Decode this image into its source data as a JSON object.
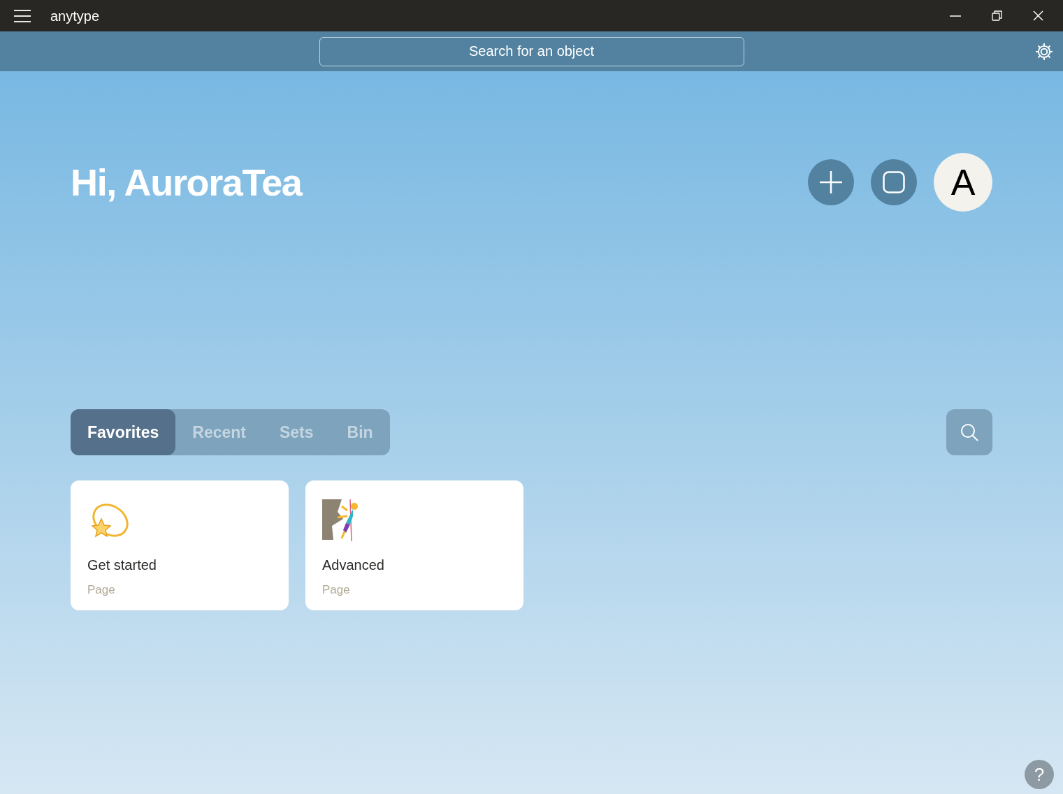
{
  "window": {
    "title": "anytype"
  },
  "search": {
    "placeholder": "Search for an object"
  },
  "greeting": "Hi, AuroraTea",
  "avatar": {
    "letter": "A"
  },
  "tabs": [
    {
      "label": "Favorites",
      "selected": true
    },
    {
      "label": "Recent",
      "selected": false
    },
    {
      "label": "Sets",
      "selected": false
    },
    {
      "label": "Bin",
      "selected": false
    }
  ],
  "cards": [
    {
      "title": "Get started",
      "type": "Page",
      "kind": "star"
    },
    {
      "title": "Advanced",
      "type": "Page",
      "kind": "climber"
    }
  ],
  "help": "?"
}
